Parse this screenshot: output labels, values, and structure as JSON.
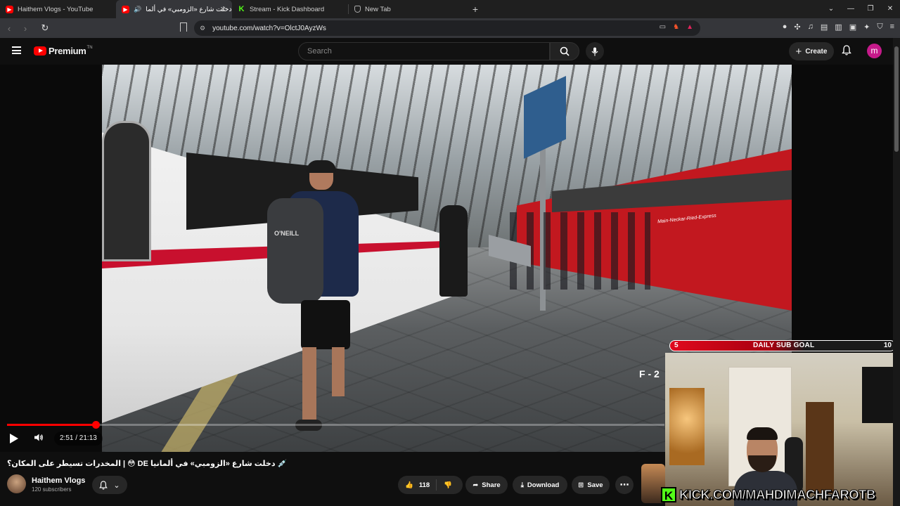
{
  "browser": {
    "tabs": [
      {
        "title": "Haithem Vlogs - YouTube",
        "icon": "youtube-icon"
      },
      {
        "title": "دخلت شارع «الزومبي» في ألما",
        "icon": "youtube-icon",
        "active": true,
        "audio": true
      },
      {
        "title": "Stream - Kick Dashboard",
        "icon": "kick-icon"
      },
      {
        "title": "New Tab",
        "icon": "brave-icon"
      }
    ],
    "url": "youtube.com/watch?v=OlctJ0AyzWs"
  },
  "youtube": {
    "logo_text": "Premium",
    "logo_tm": "TN",
    "search_placeholder": "Search",
    "create_label": "Create",
    "avatar_letter": "m"
  },
  "video": {
    "overlay_mark": "F - 2",
    "train_text": "Main-Neckar-Ried-Express",
    "backpack_text": "O'NEILL",
    "time": "2:51 / 21:13",
    "progress_fraction": 0.1343
  },
  "stream_overlay": {
    "goal_current": "5",
    "goal_label": "DAILY SUB GOAL",
    "goal_target": "10",
    "kick_url": "KICK.COM/MAHDIMACHFAROTB"
  },
  "info": {
    "title": "المخدرات تسيطر على المكان؟ | 😳 DE دخلت شارع «الزومبي» في ألمانيا 💉",
    "channel_name": "Haithem Vlogs",
    "subscribers": "120 subscribers",
    "likes": "118",
    "share_label": "Share",
    "download_label": "Download",
    "save_label": "Save"
  },
  "colors": {
    "youtube_red": "#ff0000",
    "kick_green": "#53fc18",
    "avatar": "#c51a8a"
  }
}
